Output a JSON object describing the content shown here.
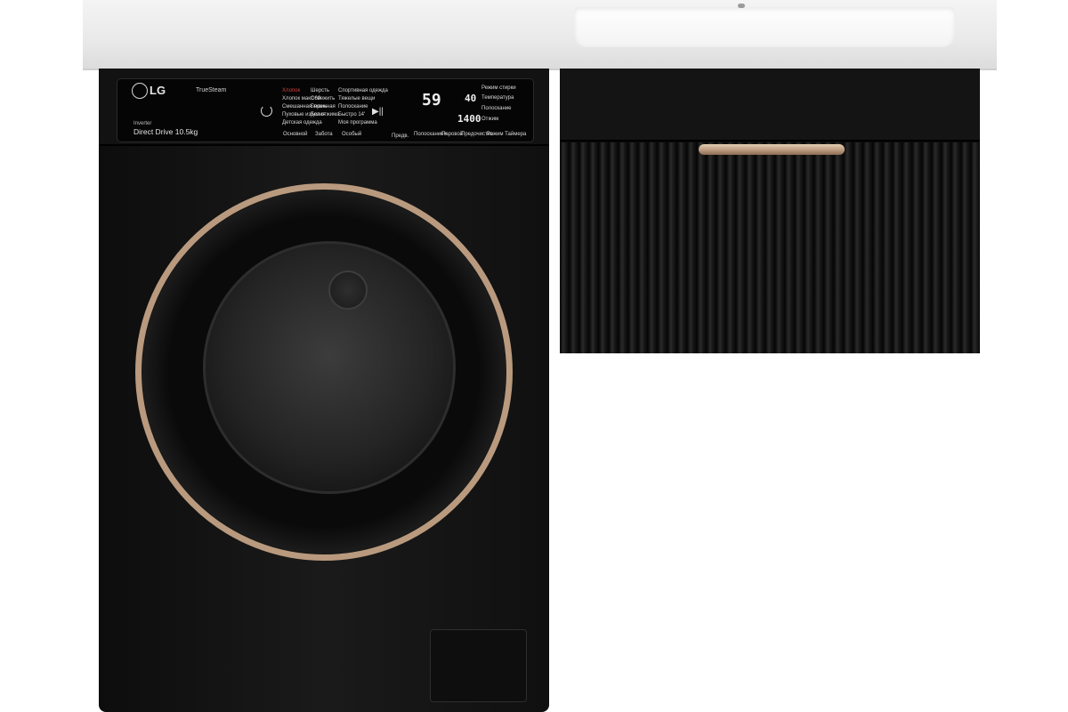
{
  "colors": {
    "cabinet": "#0b0b0b",
    "washer": "#121212",
    "door_ring": "#b99a7e",
    "handle": "#c9a988",
    "countertop": "#eeeeee"
  },
  "panel": {
    "brand": "LG",
    "truesteam": "TrueSteam",
    "inverter": "Inverter",
    "direct_drive": "Direct Drive 10.5kg",
    "programs": {
      "col1": [
        "Хлопок",
        "Хлопок макс 60",
        "Смешанная ткань",
        "Пуховые изделия",
        "Детская одежда"
      ],
      "col2": [
        "Шерсть",
        "Освежить",
        "Бережная",
        "Без отжима"
      ],
      "col3": [
        "Спортивная одежда",
        "Тяжелые вещи",
        "Полоскание",
        "Быстро 14'",
        "Моя программа"
      ]
    },
    "category_labels": [
      "Основной",
      "Забота",
      "Особый"
    ],
    "right_labels": [
      "Режим стирки",
      "Температура",
      "Полоскание",
      "Отжим"
    ],
    "display": {
      "main": "59",
      "temp": "40",
      "spin": "1400"
    },
    "bottom_labels": [
      "Предв.",
      "Полоскание+",
      "Паровой",
      "Предочистка",
      "Режим Таймера"
    ],
    "power_icon": "power-icon",
    "play_icon": "play-pause-icon"
  }
}
